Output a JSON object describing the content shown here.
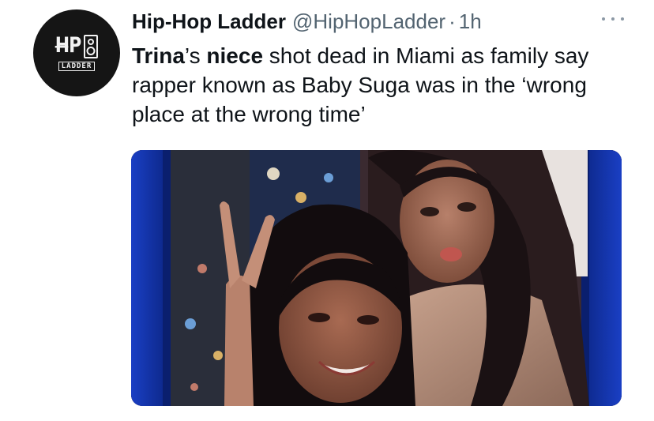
{
  "tweet": {
    "display_name": "Hip-Hop Ladder",
    "handle": "@HipHopLadder",
    "separator": "·",
    "time": "1h",
    "text_parts": {
      "p1": "Trina",
      "p2": "’s ",
      "p3": "niece",
      "p4": " shot dead in Miami as family say rapper known as Baby Suga was in the ‘wrong place at the wrong time’"
    }
  },
  "avatar": {
    "logo_top": "HIP HOP",
    "logo_bottom": "LADDER"
  },
  "colors": {
    "text": "#0f1419",
    "secondary": "#536471",
    "media_frame_blue": "#1430a8"
  },
  "icons": {
    "more": "more-dots-icon",
    "speaker": "speaker-icon"
  }
}
